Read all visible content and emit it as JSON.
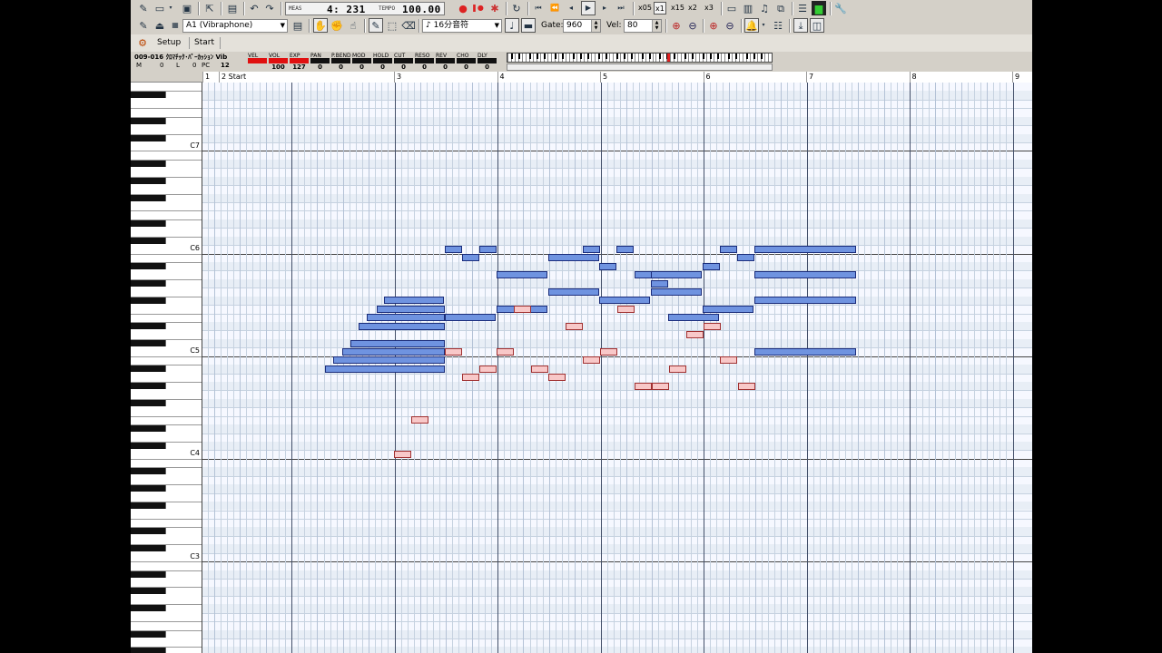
{
  "toolbar": {
    "meas_label": "MEAS",
    "position": "4: 231",
    "tempo_label": "TEMPO",
    "tempo": "100.00",
    "speeds": [
      {
        "label": "x05",
        "active": false
      },
      {
        "label": "x1",
        "active": true
      },
      {
        "label": "x15",
        "active": false
      },
      {
        "label": "x2",
        "active": false
      },
      {
        "label": "x3",
        "active": false
      }
    ]
  },
  "toolbar2": {
    "track_select": "A1  (Vibraphone)",
    "note_length": "16分音符",
    "gate_label": "Gate:",
    "gate_value": "960",
    "vel_label": "Vel:",
    "vel_value": "80"
  },
  "menu": {
    "setup": "Setup",
    "start": "Start"
  },
  "track_info": {
    "name": "009-016 ｸﾛﾏﾁｯｸ･ﾊﾟｰｶｯｼｮﾝ Vib",
    "m_label": "M",
    "m_value": "0",
    "l_label": "L",
    "l_value": "0",
    "pc_label": "PC",
    "pc_value": "12",
    "mixer": [
      {
        "label": "VEL",
        "value": "",
        "red": true
      },
      {
        "label": "VOL",
        "value": "100",
        "red": true
      },
      {
        "label": "EXP",
        "value": "127",
        "red": true
      },
      {
        "label": "PAN",
        "value": "0",
        "red": false
      },
      {
        "label": "P.BEND",
        "value": "0",
        "red": false
      },
      {
        "label": "MOD",
        "value": "0",
        "red": false
      },
      {
        "label": "HOLD",
        "value": "0",
        "red": false
      },
      {
        "label": "CUT",
        "value": "0",
        "red": false
      },
      {
        "label": "RESO",
        "value": "0",
        "red": false
      },
      {
        "label": "REV",
        "value": "0",
        "red": false
      },
      {
        "label": "CHO",
        "value": "0",
        "red": false
      },
      {
        "label": "DLY",
        "value": "0",
        "red": false
      }
    ]
  },
  "ruler": {
    "labels": [
      "1",
      "2 Start",
      "3",
      "4",
      "5",
      "6",
      "7",
      "8",
      "9"
    ]
  },
  "piano_roll": {
    "octave_labels": [
      "C7",
      "C6",
      "C5",
      "C4",
      "C3"
    ],
    "colors": {
      "note": "#6f93e0",
      "note_border": "#1a2c7a",
      "alt_note": "#f8c8c8",
      "alt_border": "#a03030",
      "grid_bg": "#f6f8ff"
    }
  }
}
